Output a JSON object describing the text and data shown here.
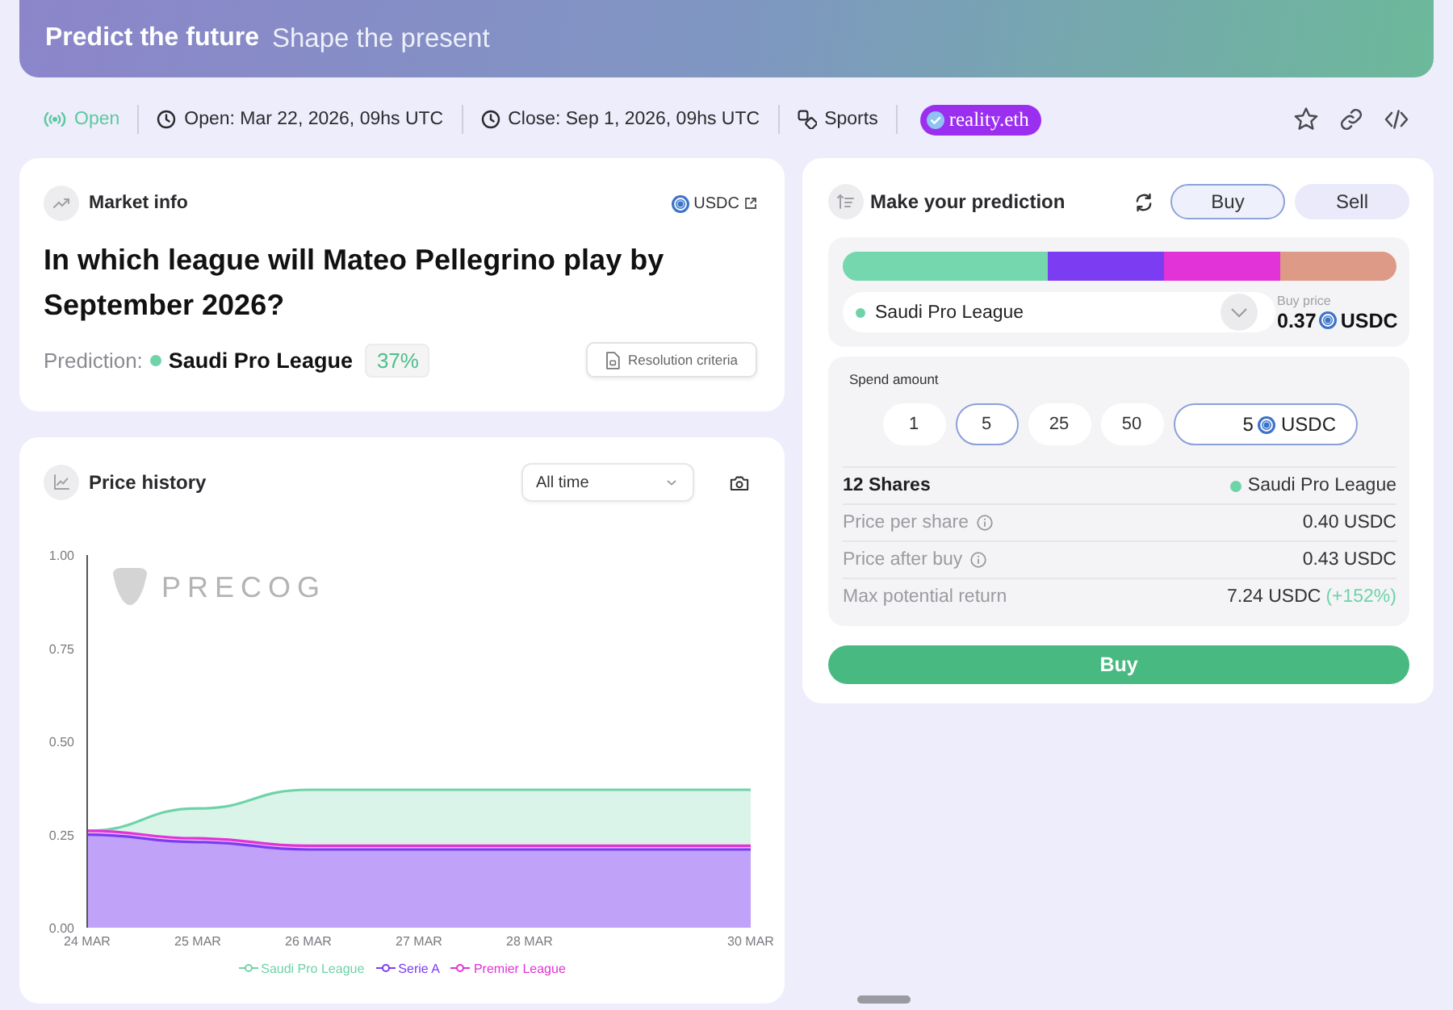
{
  "banner": {
    "title": "Predict the future",
    "subtitle": "Shape the present"
  },
  "meta": {
    "status": "Open",
    "items": [
      {
        "kind": "open_date",
        "label": "Open: Mar 22, 2026, 09hs UTC"
      },
      {
        "kind": "close_date",
        "label": "Close: Sep 1, 2026, 09hs UTC"
      },
      {
        "kind": "category",
        "label": "Sports"
      }
    ],
    "oracle": "reality.eth"
  },
  "market_info": {
    "title": "Market info",
    "currency": "USDC",
    "question": "In which league will Mateo Pellegrino play by September 2026?",
    "prediction_label": "Prediction:",
    "prediction_outcome": "Saudi Pro League",
    "prediction_percent": "37%",
    "resolution_button": "Resolution criteria"
  },
  "price_history": {
    "title": "Price history",
    "range": "All time",
    "logo_text": "PRECOG",
    "chart_data": {
      "type": "area",
      "legend": "bottom",
      "categories": [
        "24 MAR",
        "25 MAR",
        "26 MAR",
        "27 MAR",
        "28 MAR",
        null,
        "30 MAR"
      ],
      "ylim": [
        0,
        1
      ],
      "yticks": [
        {
          "value": 0,
          "label": "0.00"
        },
        {
          "value": 0.25,
          "label": "0.25"
        },
        {
          "value": 0.5,
          "label": "0.50"
        },
        {
          "value": 0.75,
          "label": "0.75"
        },
        {
          "value": 1,
          "label": "1.00"
        }
      ],
      "series": [
        {
          "name": "Saudi Pro League",
          "color": "#6fd3a9",
          "values": [
            0.26,
            0.32,
            0.37,
            0.37,
            0.37,
            0.37,
            0.37
          ]
        },
        {
          "name": "Serie A",
          "color": "#7b3cf2",
          "values": [
            0.25,
            0.23,
            0.21,
            0.21,
            0.21,
            0.21,
            0.21
          ]
        },
        {
          "name": "Premier League",
          "color": "#e133d8",
          "values": [
            0.26,
            0.24,
            0.22,
            0.22,
            0.22,
            0.22,
            0.22
          ]
        }
      ]
    }
  },
  "prediction": {
    "title": "Make your prediction",
    "modes": [
      {
        "label": "Buy",
        "selected": true
      },
      {
        "label": "Sell",
        "selected": false
      }
    ],
    "outcome_bar": [
      {
        "color": "#74d7ae"
      },
      {
        "color": "#7b3cf2"
      },
      {
        "color": "#e133d8"
      },
      {
        "color": "#dd9a87"
      }
    ],
    "selected_outcome": "Saudi Pro League",
    "buy_price_label": "Buy price",
    "buy_price": "0.37",
    "buy_price_currency": "USDC",
    "spend_label": "Spend amount",
    "presets": [
      {
        "label": "1",
        "selected": false
      },
      {
        "label": "5",
        "selected": true
      },
      {
        "label": "25",
        "selected": false
      },
      {
        "label": "50",
        "selected": false
      }
    ],
    "amount": "5",
    "amount_currency": "USDC",
    "summary": [
      {
        "kind": "shares",
        "label": "12 Shares",
        "value": "Saudi Pro League"
      },
      {
        "kind": "info",
        "label": "Price per share",
        "value": "0.40 USDC"
      },
      {
        "kind": "info",
        "label": "Price after buy",
        "value": "0.43 USDC"
      },
      {
        "kind": "return",
        "label": "Max potential return",
        "value": "7.24 USDC",
        "change": "(+152%)"
      }
    ],
    "submit": "Buy"
  }
}
